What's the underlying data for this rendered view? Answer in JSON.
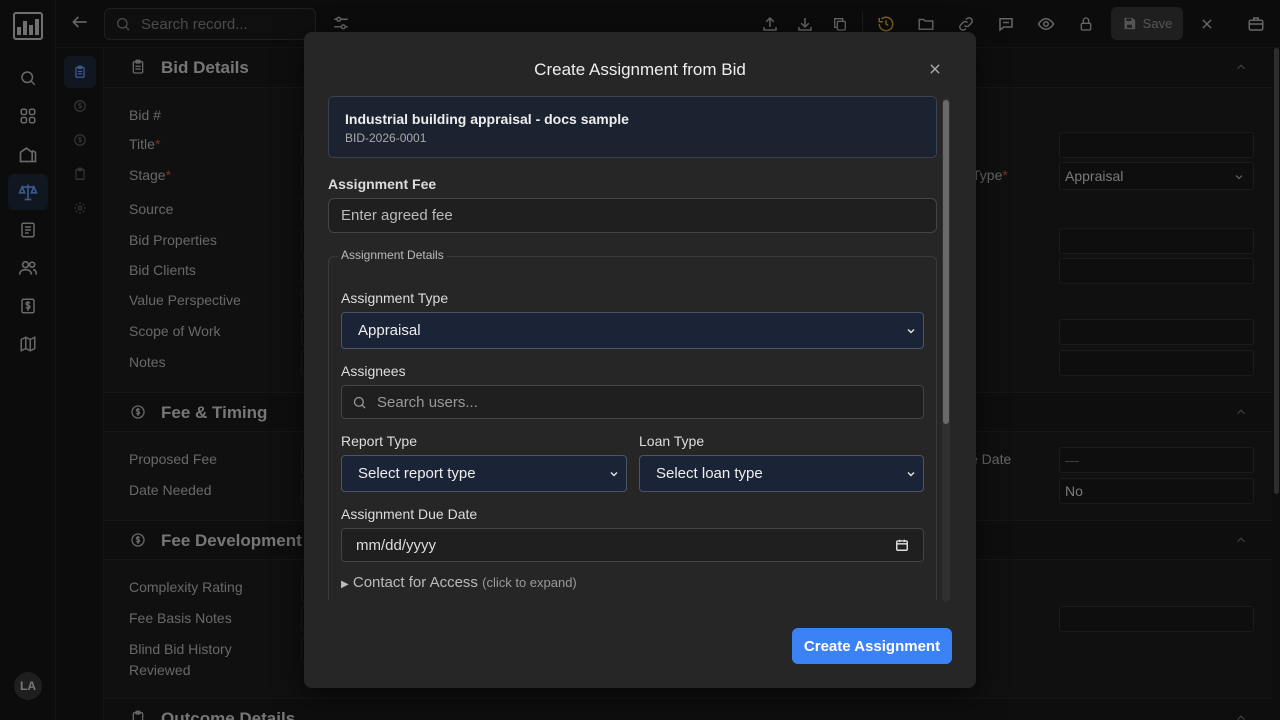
{
  "rail": {
    "avatar_initials": "LA"
  },
  "topbar": {
    "search_placeholder": "Search record...",
    "save_label": "Save"
  },
  "sections": {
    "bid_details": {
      "title": "Bid Details",
      "fields": [
        "Bid #",
        "Title",
        "Stage",
        "Source",
        "Bid Properties",
        "Bid Clients",
        "Value Perspective",
        "Scope of Work",
        "Notes"
      ],
      "type_label_partial": "Type",
      "type_value": "Appraisal"
    },
    "fee_timing": {
      "title": "Fee & Timing",
      "fields": [
        "Proposed Fee",
        "Date Needed"
      ],
      "due_date_label_partial": "e Date",
      "due_date_value": "—",
      "yes_no_value": "No"
    },
    "fee_development": {
      "title": "Fee Development",
      "fields": [
        "Complexity Rating",
        "Fee Basis Notes",
        "Blind Bid History",
        "Reviewed"
      ]
    },
    "outcome_details": {
      "title": "Outcome Details"
    }
  },
  "modal": {
    "title": "Create Assignment from Bid",
    "bid_title": "Industrial building appraisal - docs sample",
    "bid_id": "BID-2026-0001",
    "fee_label": "Assignment Fee",
    "fee_placeholder": "Enter agreed fee",
    "details_legend": "Assignment Details",
    "assignment_type_label": "Assignment Type",
    "assignment_type_value": "Appraisal",
    "assignees_label": "Assignees",
    "assignees_placeholder": "Search users...",
    "report_type_label": "Report Type",
    "report_type_value": "Select report type",
    "loan_type_label": "Loan Type",
    "loan_type_value": "Select loan type",
    "due_date_label": "Assignment Due Date",
    "due_date_value": "mm/dd/yyyy",
    "contact_label": "Contact for Access",
    "contact_hint": "(click to expand)",
    "create_label": "Create Assignment"
  }
}
